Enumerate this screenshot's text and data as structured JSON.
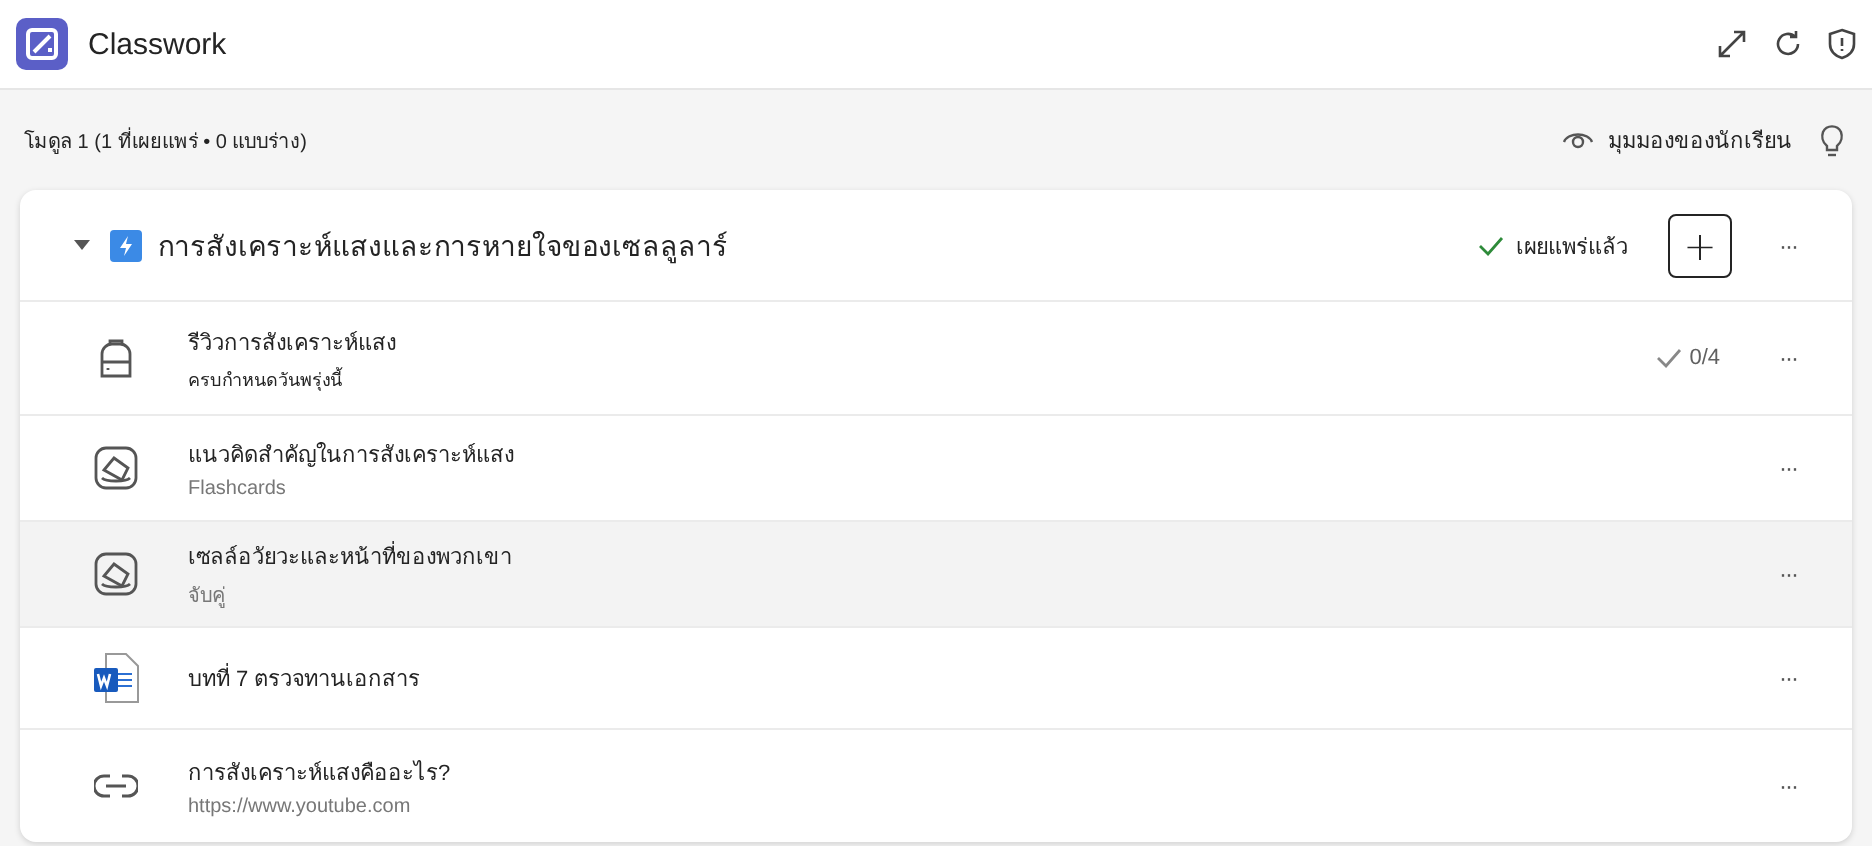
{
  "app": {
    "title": "Classwork"
  },
  "module_bar": {
    "summary": "โมดูล 1 (1 ที่เผยแพร่ • 0 แบบร่าง)",
    "student_view": "มุมมองของนักเรียน"
  },
  "module": {
    "expanded": true,
    "title": "การสังเคราะห์แสงและการหายใจของเซลลูลาร์",
    "status": "เผยแพร่แล้ว",
    "add_label": "+",
    "more": "···",
    "items": [
      {
        "kind": "assignment",
        "title": "รีวิวการสังเคราะห์แสง",
        "subtitle": "ครบกำหนดวันพรุ่งนี้",
        "count": "0/4",
        "more": "···",
        "selected": false
      },
      {
        "kind": "flashcards",
        "title": "แนวคิดสำคัญในการสังเคราะห์แสง",
        "subtitle": "Flashcards",
        "more": "···",
        "selected": false
      },
      {
        "kind": "flashcards",
        "title": "เซลล์อวัยวะและหน้าที่ของพวกเขา",
        "subtitle": "จับคู่",
        "more": "···",
        "selected": true
      },
      {
        "kind": "document",
        "title": "บทที่ 7 ตรวจทานเอกสาร",
        "more": "···",
        "selected": false
      },
      {
        "kind": "link",
        "title": "การสังเคราะห์แสงคืออะไร?",
        "subtitle": "https://www.youtube.com",
        "more": "···",
        "selected": false
      }
    ]
  }
}
